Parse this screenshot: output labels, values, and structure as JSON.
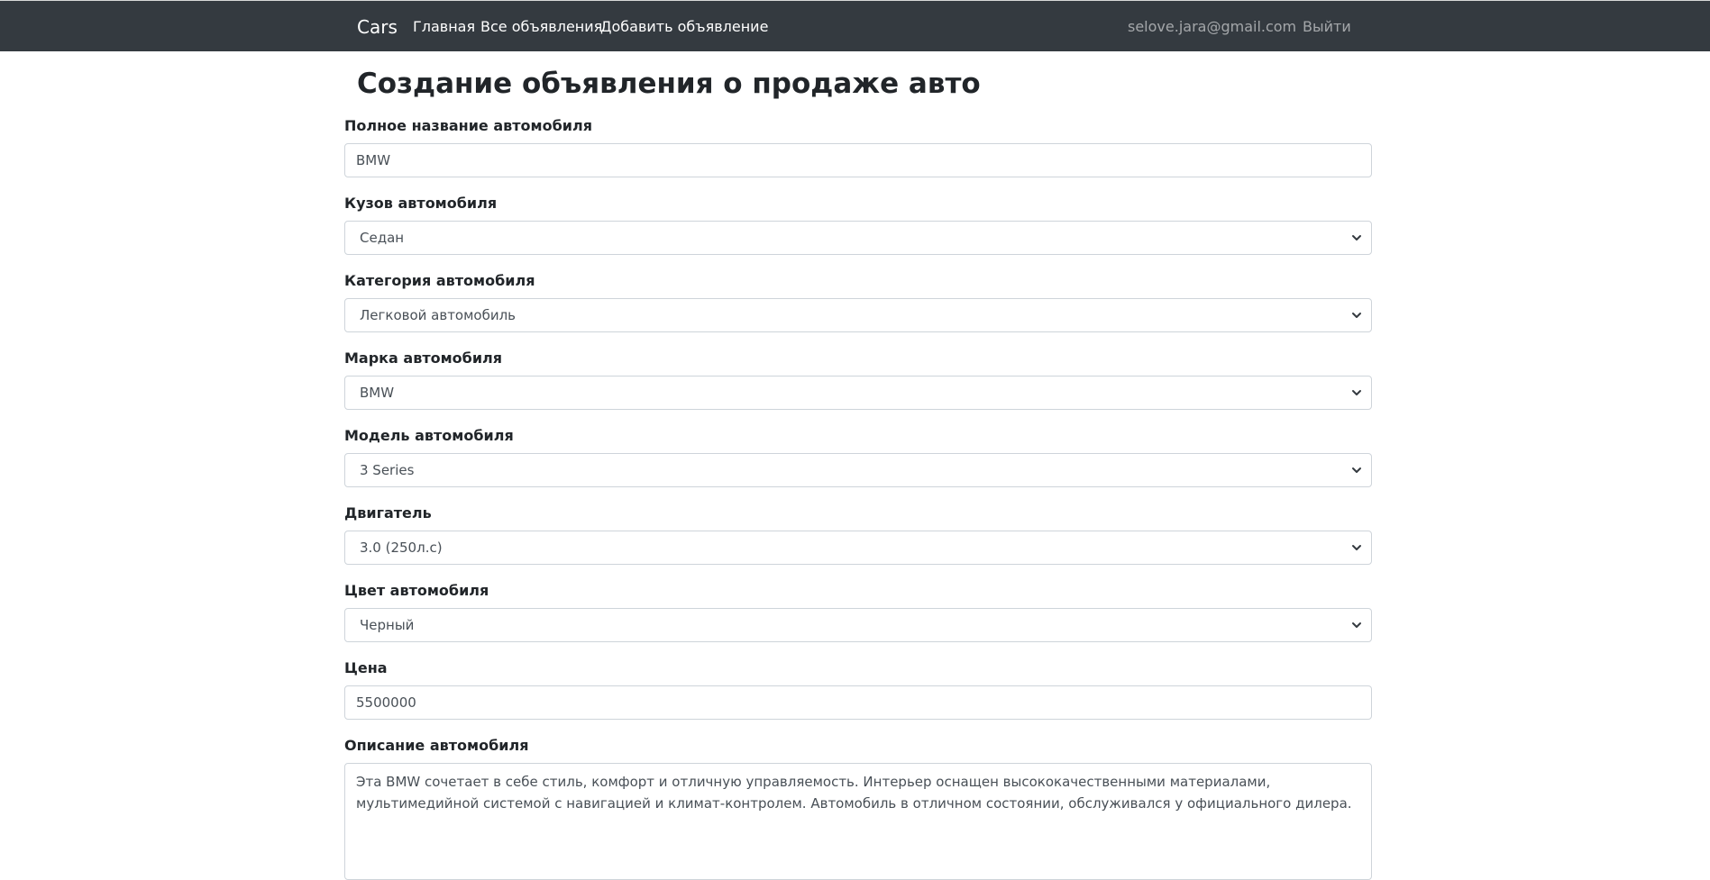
{
  "navbar": {
    "brand": "Cars",
    "links": [
      "Главная",
      "Все объявления",
      "Добавить объявление"
    ],
    "user_email": "selove.jara@gmail.com",
    "logout": "Выйти"
  },
  "page": {
    "title": "Создание объявления о продаже авто"
  },
  "form": {
    "full_name": {
      "label": "Полное название автомобиля",
      "value": "BMW"
    },
    "body": {
      "label": "Кузов автомобиля",
      "value": "Седан"
    },
    "category": {
      "label": "Категория автомобиля",
      "value": "Легковой автомобиль"
    },
    "brand": {
      "label": "Марка автомобиля",
      "value": "BMW"
    },
    "model": {
      "label": "Модель автомобиля",
      "value": "3 Series"
    },
    "engine": {
      "label": "Двигатель",
      "value": "3.0 (250л.с)"
    },
    "color": {
      "label": "Цвет автомобиля",
      "value": "Черный"
    },
    "price": {
      "label": "Цена",
      "value": "5500000"
    },
    "description": {
      "label": "Описание автомобиля",
      "value": "Эта BMW сочетает в себе стиль, комфорт и отличную управляемость. Интерьер оснащен высококачественными материалами, мультимедийной системой с навигацией и климат-контролем. Автомобиль в отличном состоянии, обслуживался у официального дилера."
    }
  },
  "icons": {
    "select_arrow": "chevron-down-icon"
  },
  "colors": {
    "navbar_bg": "#343a40",
    "border": "#ced4da"
  }
}
